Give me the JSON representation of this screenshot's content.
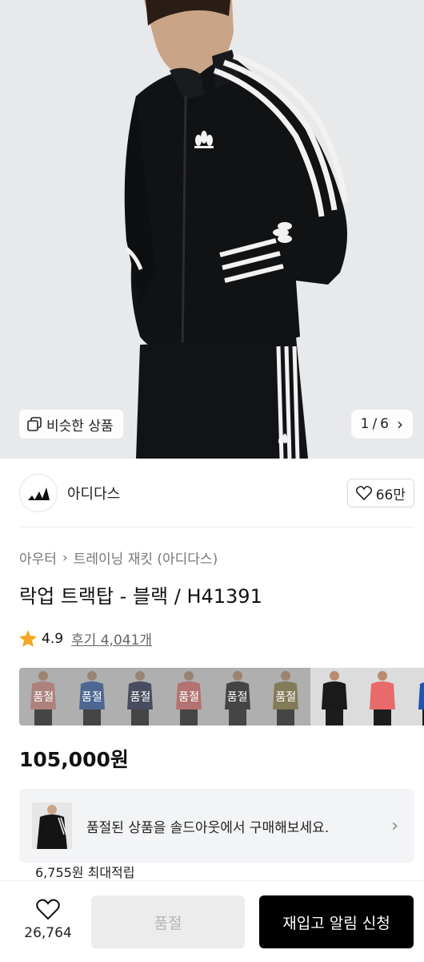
{
  "hero": {
    "similar_label": "비슷한 상품",
    "page_current": "1",
    "page_sep": "/",
    "page_total": "6",
    "chevron": "›"
  },
  "brand": {
    "name": "아디다스",
    "like_count": "66만",
    "logo_icon": "adidas-logo-icon"
  },
  "breadcrumb": {
    "items": [
      "아우터",
      "트레이닝 재킷 (아디다스)"
    ],
    "separator": "›"
  },
  "product": {
    "title": "락업 트랙탑 - 블랙 / H41391",
    "rating": "4.9",
    "review_label": "후기 4,041개",
    "price": "105,000원",
    "star_color": "#f5a623"
  },
  "colors": {
    "soldout_label": "품절",
    "thumbs": [
      {
        "color": "#d98b82",
        "soldout": true
      },
      {
        "color": "#2d5aa8",
        "soldout": true
      },
      {
        "color": "#1f2a4a",
        "soldout": true
      },
      {
        "color": "#e36f6a",
        "soldout": true
      },
      {
        "color": "#1a1a1a",
        "soldout": true
      },
      {
        "color": "#8d7f3e",
        "soldout": true
      },
      {
        "color": "#1a1a1a",
        "soldout": false
      },
      {
        "color": "#e96a6a",
        "soldout": false
      },
      {
        "color": "#1f55b5",
        "soldout": false
      }
    ]
  },
  "banner": {
    "text": "품절된 상품을 솔드아웃에서 구매해보세요.",
    "chevron": "›",
    "points": "6,755원 최대적립"
  },
  "bottom": {
    "wish_count": "26,764",
    "soldout_label": "품절",
    "restock_label": "재입고 알림 신청"
  }
}
